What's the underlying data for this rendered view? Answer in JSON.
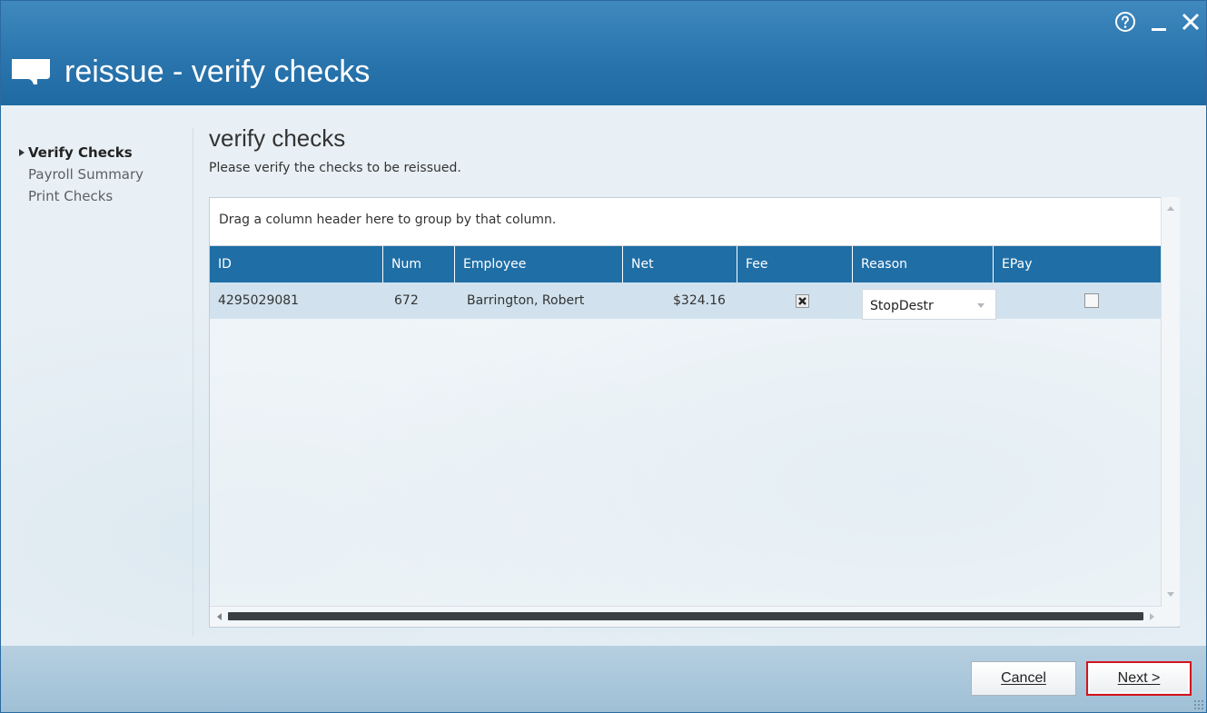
{
  "window": {
    "title": "reissue - verify checks",
    "controls": {
      "help": "help-icon",
      "minimize": "minimize-icon",
      "close": "close-icon"
    }
  },
  "nav": {
    "items": [
      {
        "label": "Verify Checks",
        "active": true
      },
      {
        "label": "Payroll Summary",
        "active": false
      },
      {
        "label": "Print Checks",
        "active": false
      }
    ]
  },
  "page": {
    "heading": "verify checks",
    "subheading": "Please verify the checks to be reissued."
  },
  "grid": {
    "group_panel_text": "Drag a column header here to group by that column.",
    "columns": [
      "ID",
      "Num",
      "Employee",
      "Net",
      "Fee",
      "Reason",
      "EPay"
    ],
    "rows": [
      {
        "id": "4295029081",
        "num": "672",
        "employee": "Barrington, Robert",
        "net": "$324.16",
        "fee": true,
        "reason": "StopDestr",
        "epay": false
      }
    ]
  },
  "footer": {
    "cancel_label": "Cancel",
    "next_label": "Next >"
  },
  "colors": {
    "title_bar": "#2a75ae",
    "header_row": "#1f6ea6",
    "selected_row": "#d1e2ee",
    "highlight_border": "#d3141c"
  }
}
